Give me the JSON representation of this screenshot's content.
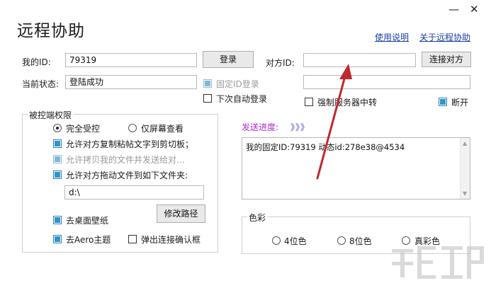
{
  "window": {
    "title": "远程协助",
    "minimize_glyph": "—",
    "close_glyph": "✕"
  },
  "links": {
    "help": "使用说明",
    "about": "关于远程协助"
  },
  "my_id": {
    "label": "我的ID:",
    "value": "79319",
    "login_button": "登录"
  },
  "status": {
    "label": "当前状态:",
    "value": "登陆成功"
  },
  "options": {
    "fixed_id_login": "固定ID登录",
    "auto_login_next": "下次自动登录"
  },
  "peer": {
    "label": "对方ID:",
    "id_value": "",
    "connect_button": "连接对方",
    "password_value": ""
  },
  "server": {
    "force_relay": "强制服务器中转",
    "disconnect": "断开"
  },
  "permissions": {
    "group_title": "被控端权限",
    "full_control": "完全受控",
    "view_only": "仅屏幕查看",
    "allow_clipboard": "允许对方复制粘帖文字到剪切板；",
    "allow_copy_files": "允许拷贝我的文件并发送给对...",
    "allow_drag_files": "允许对方拖动文件到如下文件夹:",
    "folder_path": "d:\\",
    "remove_wallpaper": "去桌面壁纸",
    "modify_path_button": "修改路径",
    "remove_aero": "去Aero主题",
    "popup_confirm": "弹出连接确认框"
  },
  "progress": {
    "label": "发送进度:",
    "arrows": "》》》"
  },
  "log": {
    "text": "我的固定ID:79319 动态id:278e38@4534"
  },
  "color_group": {
    "title": "色彩",
    "opt_4bit": "4位色",
    "opt_8bit": "8位色",
    "opt_true": "真彩色"
  },
  "colors": {
    "accent": "#2f95c9",
    "link": "#1a3fa3",
    "progress_label": "#b02ad6",
    "progress_arrows": "#4a4ad8",
    "annotation_arrow": "#c0282d"
  },
  "icons": {
    "minimize": "minimize-icon",
    "close": "close-icon",
    "annotation": "red-arrow-annotation-icon",
    "watermark": "site-logo-watermark"
  }
}
